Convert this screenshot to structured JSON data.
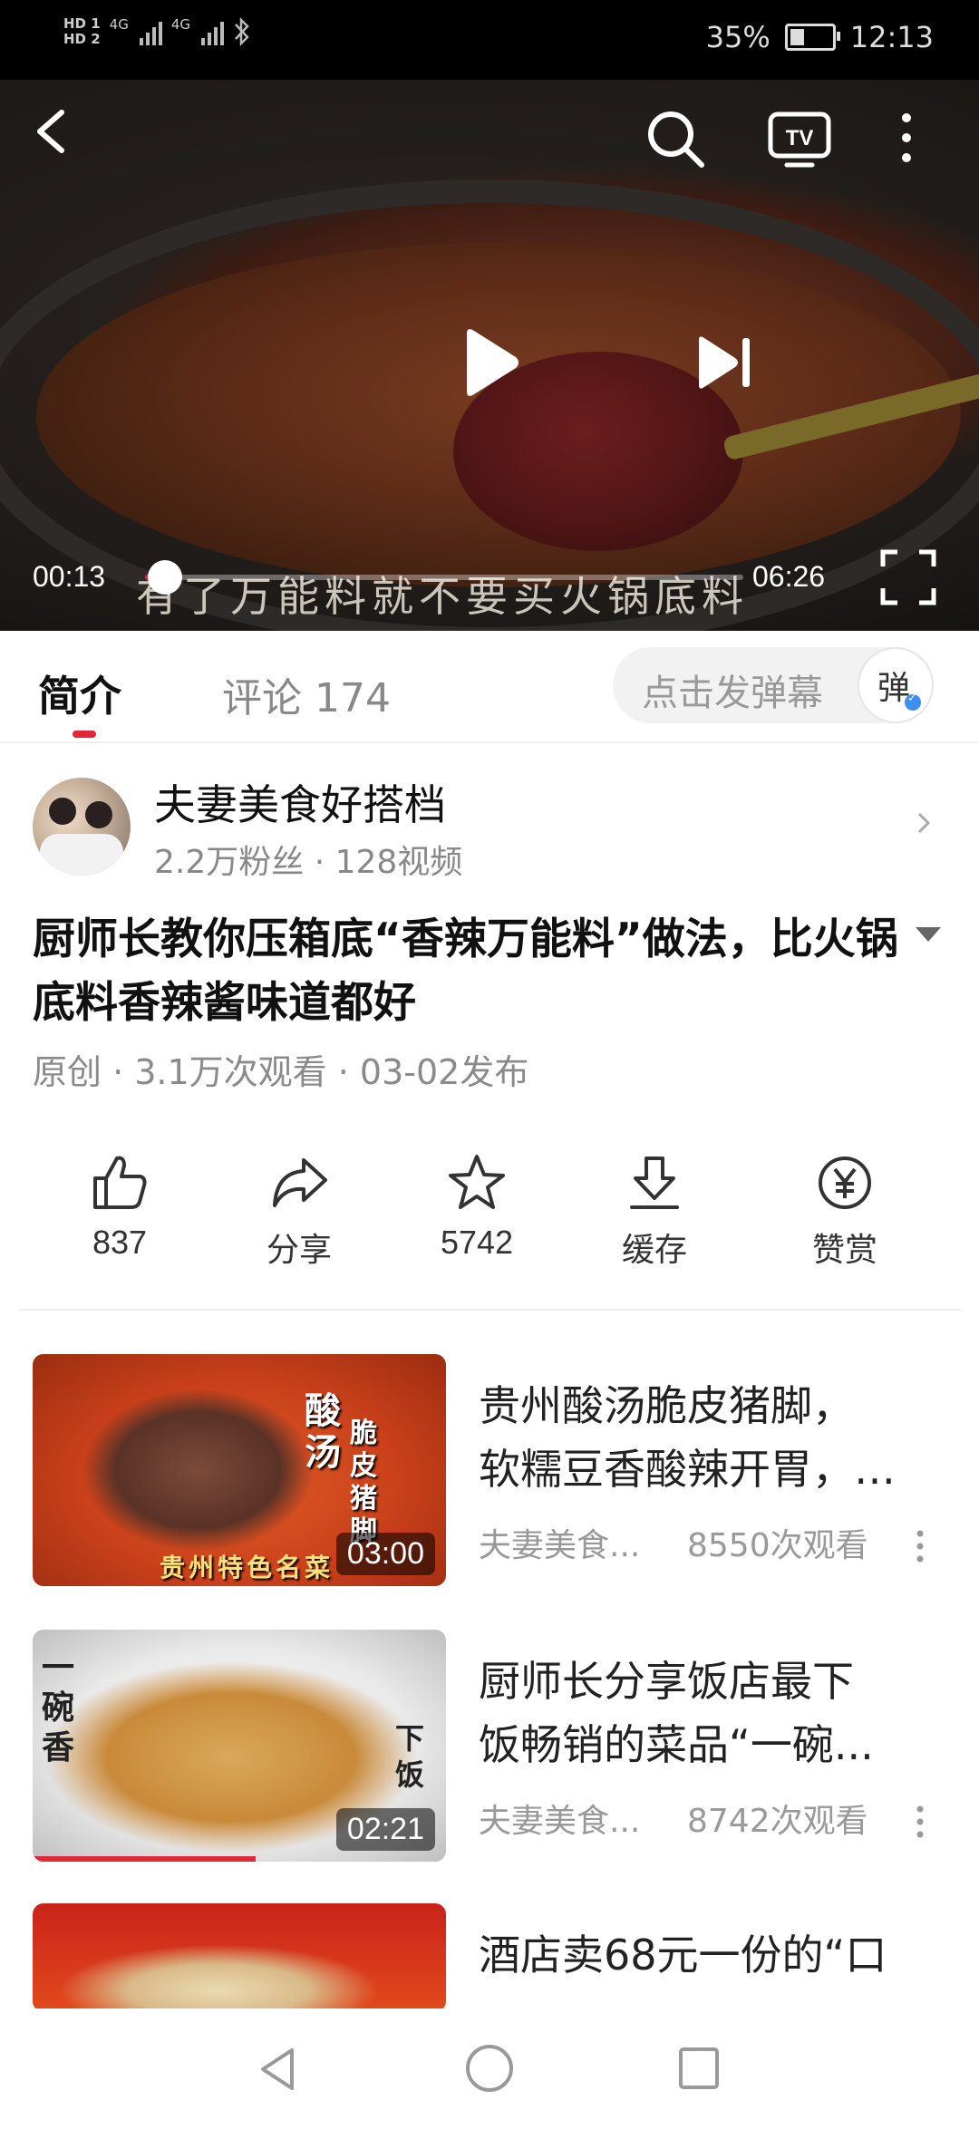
{
  "status_bar": {
    "hd1": "HD 1",
    "hd2": "HD 2",
    "signal1": "4G",
    "signal2": "4G",
    "battery_percent": "35%",
    "battery_level": 0.35,
    "time": "12:13"
  },
  "player": {
    "current_time": "00:13",
    "total_time": "06:26",
    "progress": 0.034,
    "subtitle": "有了万能料就不要买火锅底料",
    "icons": [
      "back-icon",
      "search-icon",
      "tv-icon",
      "more-icon",
      "play-icon",
      "next-icon",
      "fullscreen-icon"
    ]
  },
  "tabs": {
    "intro": "简介",
    "comments": "评论 174",
    "danmaku_placeholder": "点击发弹幕",
    "danmaku_icon": "弹"
  },
  "uploader": {
    "name": "夫妻美食好搭档",
    "stats": "2.2万粉丝 · 128视频"
  },
  "video": {
    "title": "厨师长教你压箱底“香辣万能料”做法，比火锅底料香辣酱味道都好",
    "meta": "原创 · 3.1万次观看 · 03-02发布"
  },
  "actions": {
    "like": "837",
    "share": "分享",
    "favorite": "5742",
    "cache": "缓存",
    "reward": "赞赏"
  },
  "recommendations": [
    {
      "title_line1": "贵州酸汤脆皮猪脚，",
      "title_line2": "软糯豆香酸辣开胃，…",
      "author": "夫妻美食...",
      "views": "8550次观看",
      "duration": "03:00",
      "thumb_text1": "酸汤",
      "thumb_text2": "脆皮猪脚",
      "thumb_text3": "贵州特色名菜"
    },
    {
      "title_line1": "厨师长分享饭店最下",
      "title_line2": "饭畅销的菜品“一碗...",
      "author": "夫妻美食...",
      "views": "8742次观看",
      "duration": "02:21",
      "thumb_text1": "一碗香",
      "thumb_text2": "下饭",
      "watched_fraction": 0.54
    },
    {
      "title_line1": "酒店卖68元一份的“口"
    }
  ],
  "colors": {
    "accent": "#e0283a",
    "text_primary": "#111111",
    "text_secondary": "#888888"
  }
}
